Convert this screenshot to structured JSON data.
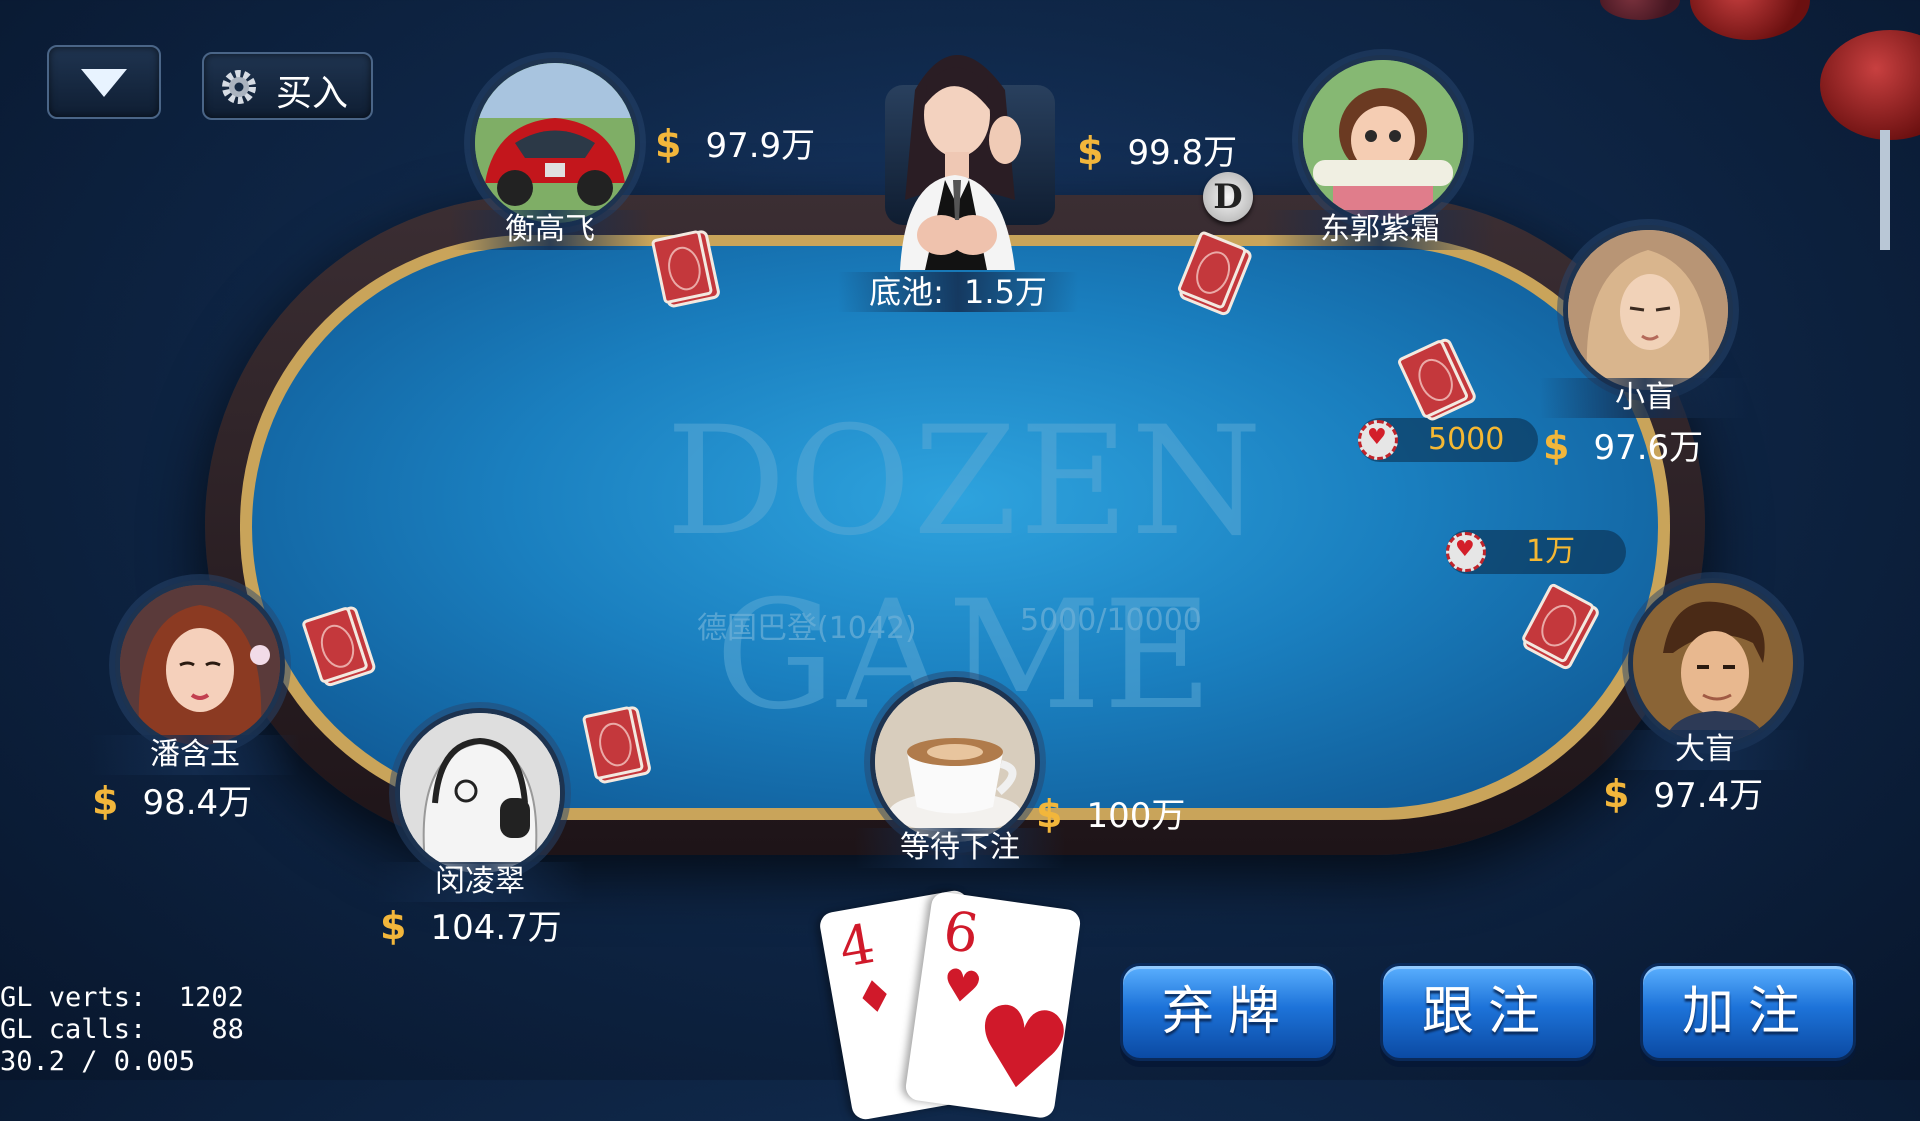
{
  "top_buttons": {
    "menu_icon": "dropdown-triangle-icon",
    "buyin_label": "买入",
    "buyin_icon": "gear-icon"
  },
  "dealer": {
    "pot_label": "底池:",
    "pot_value": "1.5万"
  },
  "table": {
    "logo": "DOZEN GAME",
    "game_name": "德国巴登(1042)",
    "blinds": "5000/10000"
  },
  "currency_symbol": "$",
  "dealer_button": "D",
  "players": {
    "top_left": {
      "name": "衡高飞",
      "chips": "97.9万"
    },
    "top_right": {
      "name": "东郭紫霜",
      "chips": "99.8万"
    },
    "small_blind": {
      "name": "小盲",
      "chips": "97.6万",
      "bet": "5000"
    },
    "big_blind": {
      "name": "大盲",
      "chips": "97.4万",
      "bet": "1万"
    },
    "left": {
      "name": "潘含玉",
      "chips": "98.4万"
    },
    "bottom_left": {
      "name": "闵凌翠",
      "chips": "104.7万"
    },
    "self": {
      "name": "等待下注",
      "chips": "100万"
    }
  },
  "hand": [
    {
      "rank": "4",
      "suit": "♦"
    },
    {
      "rank": "6",
      "suit": "♥"
    }
  ],
  "actions": {
    "fold": "弃牌",
    "call": "跟注",
    "raise": "加注"
  },
  "debug": {
    "line1": "GL verts:  1202",
    "line2": "GL calls:    88",
    "line3": "30.2 / 0.005"
  },
  "colors": {
    "accent_gold": "#f2b63b",
    "felt": "#1a7fbf",
    "button_blue": "#1d73d9",
    "card_red": "#d0192a"
  }
}
